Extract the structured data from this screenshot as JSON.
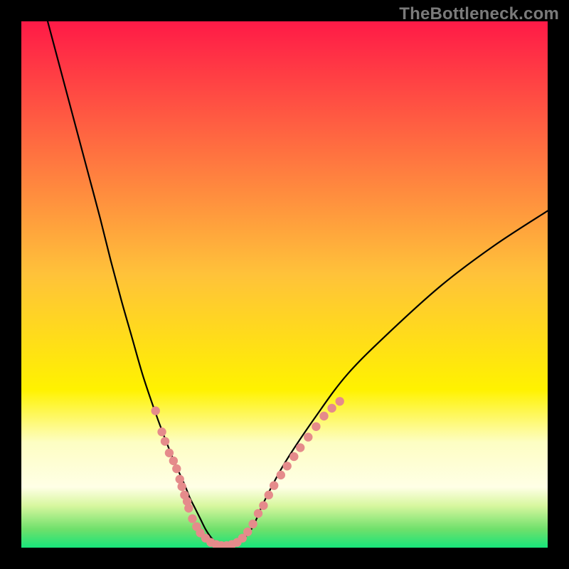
{
  "watermark": "TheBottleneck.com",
  "chart_data": {
    "type": "line",
    "title": "",
    "xlabel": "",
    "ylabel": "",
    "xlim": [
      0,
      100
    ],
    "ylim": [
      0,
      100
    ],
    "grid": false,
    "legend": false,
    "background_gradient": {
      "type": "vertical",
      "stops": [
        {
          "pos": 0.0,
          "color": "#ff1a47"
        },
        {
          "pos": 0.48,
          "color": "#ffc23a"
        },
        {
          "pos": 0.7,
          "color": "#fff200"
        },
        {
          "pos": 0.8,
          "color": "#fdfec3"
        },
        {
          "pos": 0.885,
          "color": "#ffffe6"
        },
        {
          "pos": 0.92,
          "color": "#d8f79f"
        },
        {
          "pos": 0.965,
          "color": "#6fe06b"
        },
        {
          "pos": 1.0,
          "color": "#17e47a"
        }
      ]
    },
    "series": [
      {
        "name": "curve",
        "type": "line",
        "color": "#000000",
        "x": [
          5,
          7,
          9,
          11,
          13,
          15,
          17,
          19,
          21,
          23,
          25,
          27,
          29,
          31,
          32,
          33,
          34,
          35,
          36,
          37,
          38,
          40,
          42,
          44,
          46,
          50,
          56,
          62,
          70,
          80,
          90,
          100
        ],
        "y": [
          100,
          92.5,
          85,
          77.5,
          70,
          62.5,
          54.5,
          47,
          40,
          33,
          27,
          21.5,
          16.5,
          12,
          9.5,
          7.5,
          5.5,
          3.5,
          2,
          1,
          0.5,
          0.5,
          1.5,
          4,
          8.5,
          16,
          25,
          33,
          41,
          50,
          57.5,
          64
        ]
      },
      {
        "name": "points-left",
        "type": "scatter",
        "color": "#e58b8b",
        "x": [
          25.5,
          26.7,
          27.3,
          28.1,
          28.9,
          29.5,
          30.1,
          30.5,
          31,
          31.5,
          31.8
        ],
        "y": [
          26,
          22,
          20.2,
          18,
          16.5,
          15,
          13,
          11.6,
          10,
          8.8,
          7.5
        ]
      },
      {
        "name": "points-bottom",
        "type": "scatter",
        "color": "#e58b8b",
        "x": [
          32.5,
          33.3,
          34,
          35,
          36,
          37,
          38,
          39,
          40,
          41,
          42,
          43,
          44,
          45
        ],
        "y": [
          5.5,
          4,
          2.8,
          1.8,
          1,
          0.6,
          0.4,
          0.4,
          0.6,
          1,
          1.8,
          3,
          4.5,
          6.5
        ]
      },
      {
        "name": "points-right",
        "type": "scatter",
        "color": "#e58b8b",
        "x": [
          46,
          47,
          48,
          49.3,
          50.5,
          51.8,
          53,
          54.5,
          56,
          57.5,
          59,
          60.5
        ],
        "y": [
          8,
          10,
          11.8,
          13.8,
          15.5,
          17.3,
          19,
          21,
          23,
          25,
          26.5,
          27.8
        ]
      }
    ]
  }
}
